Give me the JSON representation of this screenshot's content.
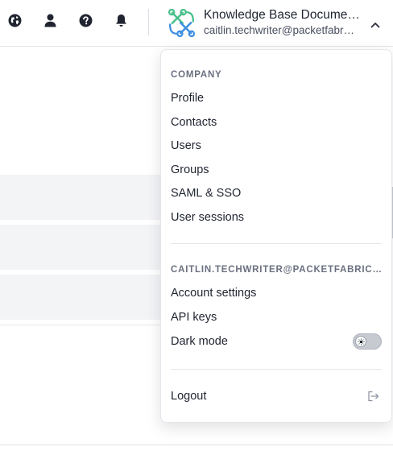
{
  "header": {
    "account": {
      "name": "Knowledge Base Documentation",
      "email": "caitlin.techwriter@packetfabric.com"
    }
  },
  "icons": {
    "globe": "globe-icon",
    "user": "user-icon",
    "help": "help-icon",
    "bell": "bell-icon",
    "logo": "packetfabric-logo",
    "chevron": "chevron-up-icon",
    "sun": "sun-icon",
    "logout": "logout-icon"
  },
  "menu": {
    "company_title": "COMPANY",
    "company_items": [
      "Profile",
      "Contacts",
      "Users",
      "Groups",
      "SAML & SSO",
      "User sessions"
    ],
    "user_title": "CAITLIN.TECHWRITER@PACKETFABRIC.COM",
    "user_items": [
      "Account settings",
      "API keys"
    ],
    "dark_mode_label": "Dark mode",
    "dark_mode_enabled": false,
    "logout_label": "Logout"
  },
  "colors": {
    "logo_green": "#46c08a",
    "logo_blue": "#3c8fe0",
    "icon_dark": "#1f2430"
  }
}
